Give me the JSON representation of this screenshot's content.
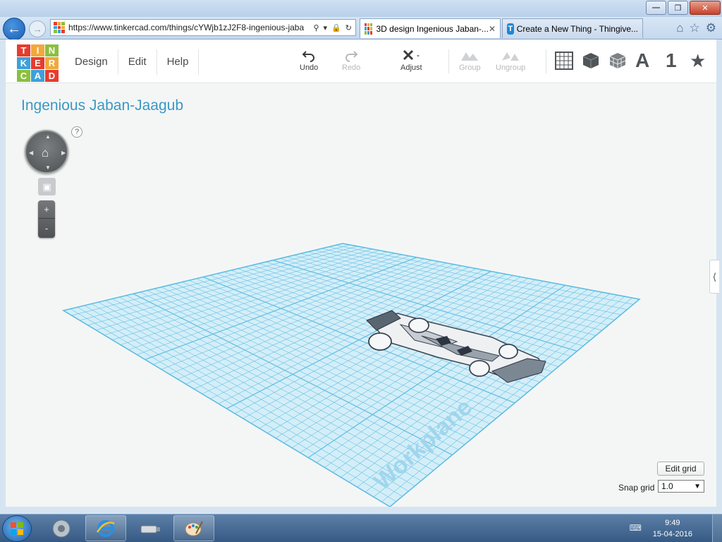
{
  "browser": {
    "address": "https://www.tinkercad.com/things/cYWjb1zJ2F8-ingenious-jaba",
    "tabs": [
      {
        "label": "3D design Ingenious Jaban-...",
        "active": true
      },
      {
        "label": "Create a New Thing - Thingive...",
        "active": false
      }
    ]
  },
  "app": {
    "logo_letters": [
      "T",
      "I",
      "N",
      "K",
      "E",
      "R",
      "C",
      "A",
      "D"
    ],
    "logo_colors": [
      "#e63c2e",
      "#f2a83a",
      "#8cbf3f",
      "#3fa0d8",
      "#e63c2e",
      "#f2a83a",
      "#8cbf3f",
      "#3fa0d8",
      "#e63c2e"
    ],
    "menu": {
      "design": "Design",
      "edit": "Edit",
      "help": "Help"
    },
    "toolbar": {
      "undo": "Undo",
      "redo": "Redo",
      "adjust": "Adjust",
      "group": "Group",
      "ungroup": "Ungroup",
      "text_tool": "A",
      "ruler_tool": "1"
    },
    "design_title": "Ingenious Jaban-Jaagub",
    "help_mark": "?",
    "zoom_in": "+",
    "zoom_out": "-",
    "side_panel_toggle": "⟨",
    "workplane_label": "Workplane",
    "edit_grid": "Edit grid",
    "snap_grid_label": "Snap grid",
    "snap_grid_value": "1.0",
    "accent_color": "#3b98c6",
    "grid_color": "#4fb6dc"
  },
  "taskbar": {
    "time": "9:49",
    "date": "15-04-2016"
  }
}
